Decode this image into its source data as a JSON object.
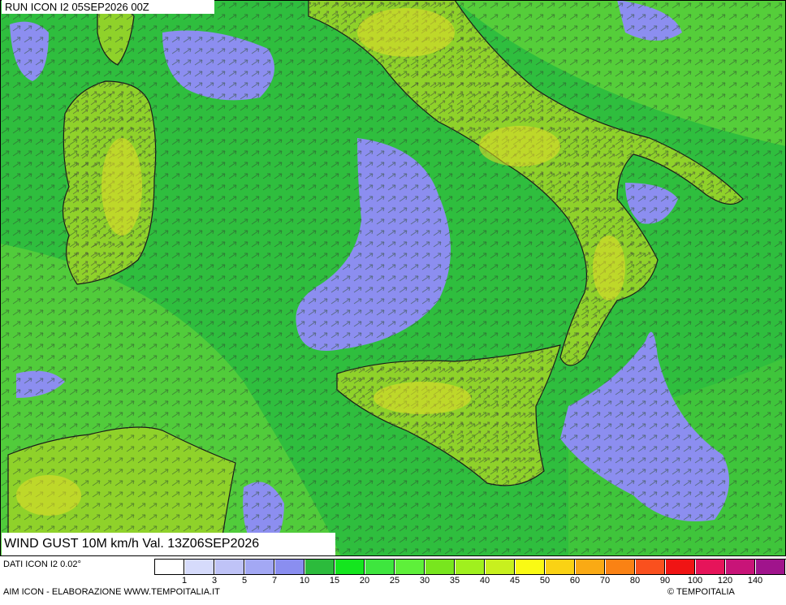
{
  "header": {
    "run_label": "RUN ICON I2 05SEP2026 00Z"
  },
  "map": {
    "variable_label": "WIND GUST 10M km/h Val. 13Z06SEP2026",
    "background_sea_color": "#2fbe3e",
    "land_color": "#8fd22a",
    "calm_color": "#8c8ef0",
    "border_color": "#1a1a1a",
    "arrow_color": "#3d4a3d"
  },
  "footer": {
    "source_label": "DATI ICON I2 0.02°",
    "credit_label": "AIM ICON - ELABORAZIONE WWW.TEMPOITALIA.IT",
    "copyright_label": "© TEMPOITALIA"
  },
  "legend": {
    "colors": [
      "#ffffff",
      "#d6dbfb",
      "#bfc3f7",
      "#a3a8f4",
      "#8a8ef0",
      "#2cbb3c",
      "#14e61e",
      "#3ee63e",
      "#5ef03a",
      "#78e61e",
      "#a0f01e",
      "#c8f01e",
      "#fafa14",
      "#fad214",
      "#faaa14",
      "#fa8214",
      "#fa501e",
      "#f01414",
      "#e6145a",
      "#c81478",
      "#a0148c",
      "#780a64"
    ],
    "ticks": [
      "1",
      "3",
      "5",
      "7",
      "10",
      "15",
      "20",
      "25",
      "30",
      "35",
      "40",
      "45",
      "50",
      "60",
      "70",
      "80",
      "90",
      "100",
      "120",
      "140"
    ]
  }
}
